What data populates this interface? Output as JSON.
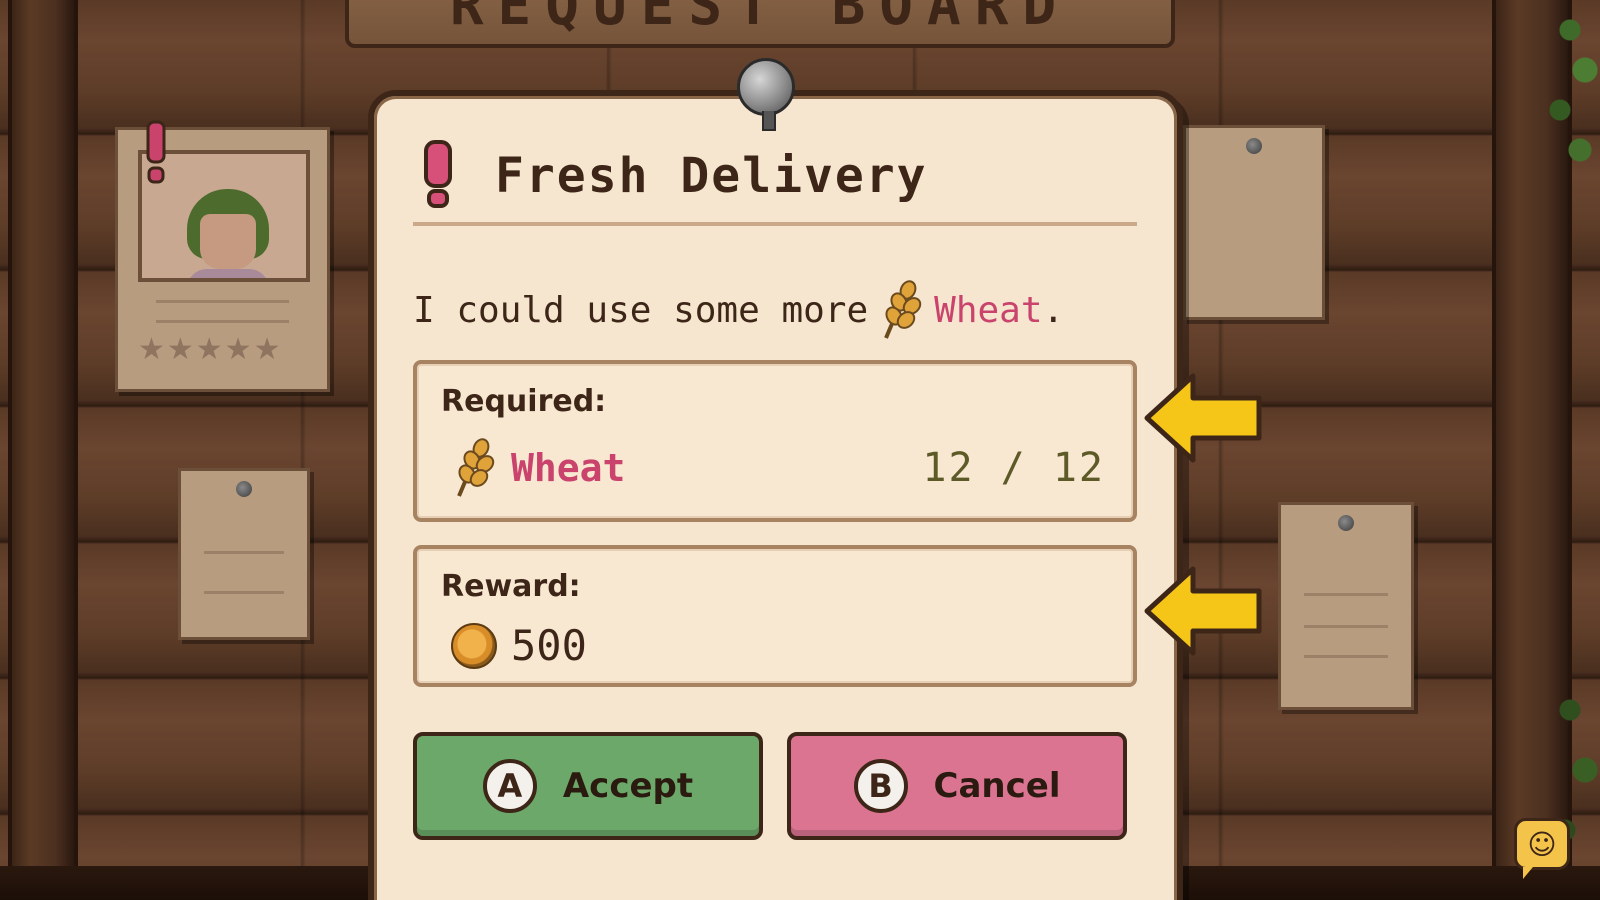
{
  "board": {
    "title": "REQUEST BOARD"
  },
  "side_notes": {
    "portrait_rating_stars": 5,
    "portrait_stars_text": "★★★★★"
  },
  "quest": {
    "title": "Fresh Delivery",
    "description_prefix": "I could use some more",
    "description_item": "Wheat",
    "description_suffix": ".",
    "required": {
      "label": "Required:",
      "item_icon": "wheat-icon",
      "item_name": "Wheat",
      "count": "12 / 12"
    },
    "reward": {
      "label": "Reward:",
      "icon": "coin-icon",
      "value": "500"
    }
  },
  "buttons": {
    "accept": {
      "glyph": "A",
      "label": "Accept"
    },
    "cancel": {
      "glyph": "B",
      "label": "Cancel"
    }
  },
  "chat": {
    "glyph": "☺"
  },
  "colors": {
    "paper": "#f6e6cf",
    "ink": "#3d2618",
    "highlight": "#c9436c",
    "accept": "#6ca86a",
    "cancel": "#db7491",
    "arrow": "#f5c518"
  }
}
